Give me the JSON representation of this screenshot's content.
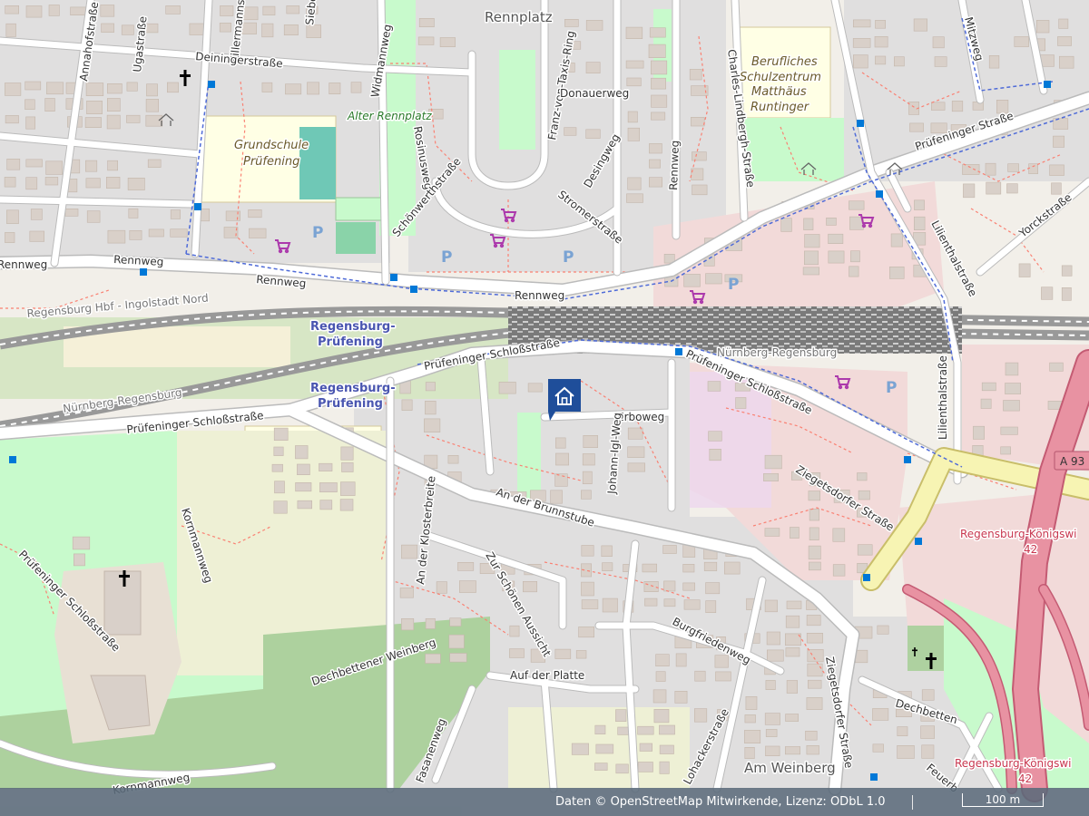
{
  "map": {
    "places": {
      "rennplatz": "Rennplatz",
      "alter_rennplatz": "Alter Rennplatz",
      "am_weinberg": "Am Weinberg"
    },
    "schools": {
      "grundschule": [
        "Grundschule",
        "Prüfening"
      ],
      "berufliches": [
        "Berufliches",
        "Schulzentrum",
        "Matthäus",
        "Runtinger"
      ]
    },
    "stations": {
      "regensburg_pruefening_1": [
        "Regensburg-",
        "Prüfening"
      ],
      "regensburg_pruefening_2": [
        "Regensburg-",
        "Prüfening"
      ],
      "regensburg_koenigswiesen_1": [
        "Regensburg-Königswi",
        "42"
      ],
      "regensburg_koenigswiesen_2": [
        "Regensburg-Königswi",
        "42"
      ]
    },
    "railways": {
      "regensburg_ingolstadt": "Regensburg Hbf - Ingolstadt Nord",
      "nuernberg_regensburg_left": "Nürnberg-Regensburg",
      "nuernberg_regensburg_right": "Nürnberg-Regensburg"
    },
    "highway_ref": "A 93",
    "streets": {
      "annahofstrasse": "Annahofstraße",
      "ugastrasse": "Ugastraße",
      "killermannstrasse": "Killermannstraße",
      "siebenstrasse": "Siebenstraße",
      "deiningerstrasse": "Deiningerstraße",
      "widmannweg": "Widmannweg",
      "rosinusweg": "Rosinusweg",
      "schoenwerthstrasse": "Schönwerthstraße",
      "franz_von_taxis_ring": "Franz-von-Taxis-Ring",
      "donauerweg": "Donauerweg",
      "desingweg": "Desingweg",
      "stromerstrasse": "Stromerstraße",
      "rennweg_label": "Rennweg",
      "charles_lindbergh_strasse": "Charles-Lindbergh-Straße",
      "mitzweg": "Mitzweg",
      "pruefeninger_strasse": "Prüfeninger Straße",
      "yorckstrasse": "Yorckstraße",
      "lilienthalstrasse": "Lilienthalstraße",
      "rennweg_west": "Rennweg",
      "rennweg_mid": "Rennweg",
      "rennweg_east": "Rennweg",
      "pruefeninger_schlossstrasse_north": "Prüfeninger Schloßstraße",
      "pruefeninger_schlossstrasse_ne": "Prüfeninger Schloßstraße",
      "pruefeninger_schlossstrasse_west": "Prüfeninger Schloßstraße",
      "pruefeninger_schlossstrasse_sw": "Prüfeninger Schloßstraße",
      "erboweg": "Erboweg",
      "johann_igl_weg": "Johann-Igl-Weg",
      "an_der_brunnstube": "An der Brunnstube",
      "an_der_klosterbreite": "An der Klosterbreite",
      "zur_schoenen_aussicht": "Zur Schönen Aussicht",
      "ziegetsdorfer_strasse_east": "Ziegetsdorfer Straße",
      "ziegetsdorfer_strasse_south": "Ziegetsdorfer Straße",
      "kornmannweg_north": "Kornmannweg",
      "kornmannweg_south": "Kornmannweg",
      "dechbettener_weinberg": "Dechbettener Weinberg",
      "burgfriedenweg": "Burgfriedenweg",
      "auf_der_platte": "Auf der Platte",
      "fasanenweg": "Fasanenweg",
      "lohackerstrasse": "Lohackerstraße",
      "dechbetten": "Dechbetten",
      "feuerbachstrasse": "Feuerb"
    }
  },
  "footer": {
    "attribution": "Daten © OpenStreetMap Mitwirkende, Lizenz: ODbL 1.0",
    "scale_label": "100 m"
  },
  "colors": {
    "background": "#f2efe9",
    "residential": "#e0dfdf",
    "building": "#d9d0c9",
    "park": "#c8facc",
    "forest": "#add19e",
    "commercial": "#f2dad9",
    "retail": "#ffd6d1",
    "school": "#ffffe5",
    "motorway": "#e892a2",
    "primary": "#fcd6a4",
    "trunk": "#f9f1b0",
    "railway": "#707070",
    "bus_stop": "#0078d7",
    "route": "#4f6bd8",
    "marker": "#1f4e9a"
  },
  "icons": [
    "church-icon",
    "shop-icon",
    "parking-icon",
    "shelter-icon",
    "bus-stop-icon",
    "home-marker-icon"
  ]
}
